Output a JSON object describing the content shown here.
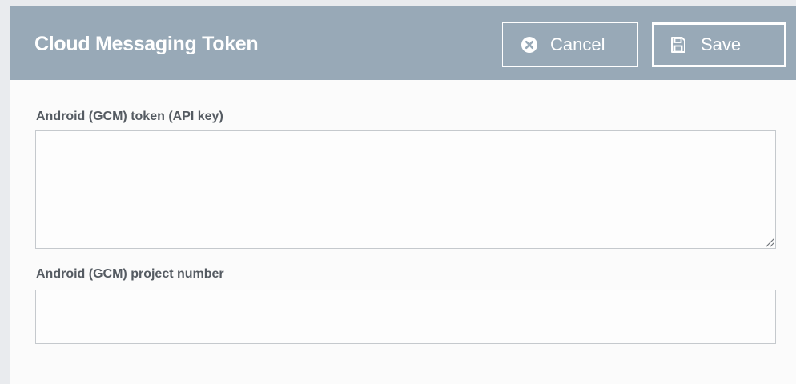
{
  "dialog": {
    "title": "Cloud Messaging Token",
    "cancel_label": "Cancel",
    "save_label": "Save",
    "cancel_icon": "close-circle-icon",
    "save_icon": "floppy-disk-icon"
  },
  "fields": {
    "token": {
      "label": "Android (GCM) token (API key)",
      "value": "",
      "placeholder": ""
    },
    "project_number": {
      "label": "Android (GCM) project number",
      "value": "",
      "placeholder": ""
    }
  },
  "colors": {
    "header_bg": "#98a9b7",
    "header_text": "#ffffff",
    "label_text": "#555b62",
    "input_border": "#c5c9cd",
    "panel_bg": "#fbfbfb"
  }
}
